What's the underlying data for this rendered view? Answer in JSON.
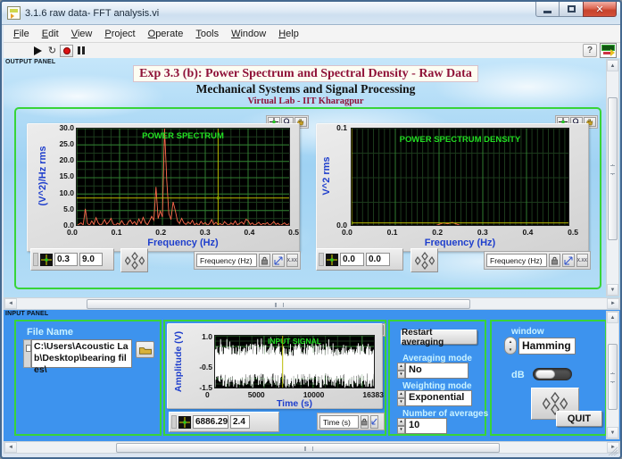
{
  "window": {
    "title": "3.1.6 raw data- FFT analysis.vi"
  },
  "icons": {
    "close": "✕",
    "help": "?",
    "run_continuous": "↻",
    "scroll_left": "◄",
    "scroll_right": "►",
    "scroll_up": "▲",
    "scroll_down": "▼",
    "spinner_up": "▲",
    "spinner_down": "▼",
    "format_button": "X.XX"
  },
  "menu": {
    "items": [
      "File",
      "Edit",
      "View",
      "Project",
      "Operate",
      "Tools",
      "Window",
      "Help"
    ]
  },
  "output_panel": {
    "label": "OUTPUT PANEL",
    "title": "Exp 3.3 (b): Power Spectrum and Spectral Density - Raw Data",
    "subtitle": "Mechanical Systems and Signal Processing",
    "subsubtitle": "Virtual Lab  - IIT Kharagpur",
    "power_spectrum": {
      "title": "POWER SPECTRUM",
      "ylabel": "(V^2)/Hz rms",
      "xlabel": "Frequency (Hz)",
      "yticks": [
        "30.0",
        "25.0",
        "20.0",
        "15.0",
        "10.0",
        "5.0",
        "0.0"
      ],
      "xticks": [
        "0.0",
        "0.1",
        "0.2",
        "0.3",
        "0.4",
        "0.5"
      ],
      "cursor_x": "0.3",
      "cursor_y": "9.0",
      "scale_legend": "Frequency (Hz)"
    },
    "psd": {
      "title": "POWER SPECTRUM DENSITY",
      "ylabel": "V^2 rms",
      "xlabel": "Frequency (Hz)",
      "yticks": [
        "0.1",
        "0.0"
      ],
      "xticks": [
        "0.0",
        "0.1",
        "0.2",
        "0.3",
        "0.4",
        "0.5"
      ],
      "cursor_x": "0.0",
      "cursor_y": "0.0",
      "scale_legend": "Frequency (Hz)"
    }
  },
  "input_panel": {
    "label": "INPUT PANEL",
    "file_name": {
      "label": "File Name",
      "path": "C:\\Users\\Acoustic Lab\\Desktop\\bearing files\\"
    },
    "input_signal": {
      "title": "INPUT SIGNAL",
      "ylabel": "Amplitude (V)",
      "xlabel": "Time (s)",
      "yticks": [
        "1.0",
        "-0.5",
        "-1.5"
      ],
      "xticks": [
        "0",
        "5000",
        "10000",
        "16383"
      ],
      "cursor_x": "6886.29",
      "cursor_y": "2.4",
      "scale_legend": "Time (s)"
    },
    "controls": {
      "restart": "Restart averaging",
      "averaging_mode_label": "Averaging mode",
      "averaging_mode_value": "No",
      "weighting_mode_label": "Weighting mode",
      "weighting_mode_value": "Exponential",
      "num_averages_label": "Number of averages",
      "num_averages_value": "10",
      "window_label": "window",
      "window_value": "Hamming",
      "db_label": "dB",
      "quit": "QUIT"
    }
  },
  "colors": {
    "input_panel_bg": "#3d93ee",
    "frame_green": "#38d438",
    "plot_line": "#ff6a4d",
    "cursor_yellow": "#b9b900",
    "chart_title_green": "#22dd22",
    "axis_label_blue": "#1e3ecc",
    "heading_maroon": "#8f1238"
  },
  "chart_data": [
    {
      "id": "power-spectrum",
      "type": "line",
      "title": "POWER SPECTRUM",
      "xlabel": "Frequency (Hz)",
      "ylabel": "(V^2)/Hz rms",
      "xlim": [
        0,
        0.5
      ],
      "ylim": [
        0,
        30
      ],
      "x0": 0,
      "dx": 0.005,
      "values": [
        0.3,
        0.8,
        1.2,
        0.6,
        5.5,
        1.0,
        0.5,
        1.8,
        0.7,
        2.8,
        1.2,
        0.5,
        1.0,
        2.2,
        0.8,
        1.5,
        2.6,
        0.9,
        0.4,
        1.1,
        0.7,
        1.9,
        0.8,
        0.3,
        1.4,
        2.1,
        0.9,
        1.6,
        0.5,
        2.4,
        1.0,
        2.9,
        1.3,
        0.6,
        1.8,
        3.2,
        2.0,
        12.2,
        2.5,
        4.8,
        3.0,
        30.0,
        14.5,
        4.0,
        2.2,
        7.6,
        5.0,
        1.8,
        1.0,
        2.6,
        1.2,
        0.7,
        1.5,
        0.9,
        2.0,
        0.6,
        1.1,
        0.4,
        1.7,
        0.8,
        1.3,
        0.5,
        1.0,
        2.2,
        0.7,
        1.4,
        0.6,
        1.0,
        0.4,
        1.6,
        0.9,
        0.5,
        1.2,
        0.7,
        1.8,
        0.6,
        1.0,
        1.5,
        0.8,
        2.3,
        1.9,
        0.7,
        1.2,
        0.5,
        0.9,
        1.4,
        0.6,
        1.0,
        0.8,
        1.3,
        0.5,
        0.9,
        1.6,
        0.7,
        1.1,
        0.4,
        0.8,
        1.2,
        0.6,
        0.9,
        0.5
      ],
      "cursor": {
        "x": 0.33,
        "y": 8.8
      },
      "grid": {
        "x_major": 0.1,
        "x_minor": 0.02,
        "y_major": 5,
        "y_minor": 2.5
      },
      "line_color": "#ff6a4d"
    },
    {
      "id": "psd",
      "type": "line",
      "title": "POWER SPECTRUM DENSITY",
      "xlabel": "Frequency (Hz)",
      "ylabel": "V^2 rms",
      "xlim": [
        0,
        0.5
      ],
      "ylim": [
        0,
        0.1
      ],
      "x0": 0,
      "dx": 0.01,
      "values": [
        0.001,
        0.0008,
        0.0012,
        0.0006,
        0.0015,
        0.001,
        0.0007,
        0.0012,
        0.0009,
        0.0014,
        0.001,
        0.0006,
        0.0011,
        0.0008,
        0.0013,
        0.0009,
        0.0012,
        0.0007,
        0.0015,
        0.001,
        0.0025,
        0.004,
        0.003,
        0.0045,
        0.0028,
        0.0012,
        0.0009,
        0.0013,
        0.0008,
        0.0011,
        0.0007,
        0.0012,
        0.0009,
        0.0006,
        0.001,
        0.0008,
        0.0013,
        0.0007,
        0.0011,
        0.0009,
        0.0014,
        0.0008,
        0.0006,
        0.001,
        0.0012,
        0.0007,
        0.0009,
        0.0011,
        0.0006,
        0.0008,
        0.0005
      ],
      "cursor": {
        "x": 0.0,
        "y": 0.004
      },
      "grid": {
        "x_major": 0.1,
        "x_minor": 0.0125,
        "y_minor": 0.025
      },
      "line_color": "#ff6a4d"
    },
    {
      "id": "input-signal",
      "type": "noise",
      "title": "INPUT SIGNAL",
      "xlabel": "Time (s)",
      "ylabel": "Amplitude (V)",
      "xlim": [
        0,
        16383
      ],
      "ylim": [
        -1.5,
        1.0
      ],
      "noise": {
        "n": 260,
        "mean": -0.3,
        "seed": 7
      },
      "cursor": {
        "x": 6886.29,
        "y": 2.4
      },
      "grid": {
        "x_major": 5000,
        "x_minor": 1250,
        "y_major": 0.5,
        "y_minor": 0.25
      },
      "line_color": "#ffffff"
    }
  ]
}
